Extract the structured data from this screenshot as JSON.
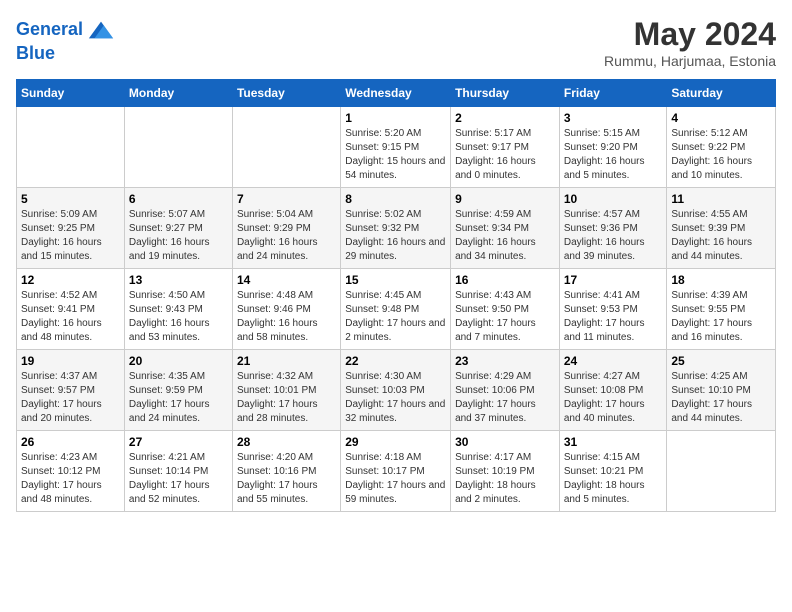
{
  "header": {
    "logo_line1": "General",
    "logo_line2": "Blue",
    "month": "May 2024",
    "location": "Rummu, Harjumaa, Estonia"
  },
  "days_of_week": [
    "Sunday",
    "Monday",
    "Tuesday",
    "Wednesday",
    "Thursday",
    "Friday",
    "Saturday"
  ],
  "weeks": [
    [
      {
        "num": "",
        "info": ""
      },
      {
        "num": "",
        "info": ""
      },
      {
        "num": "",
        "info": ""
      },
      {
        "num": "1",
        "info": "Sunrise: 5:20 AM\nSunset: 9:15 PM\nDaylight: 15 hours and 54 minutes."
      },
      {
        "num": "2",
        "info": "Sunrise: 5:17 AM\nSunset: 9:17 PM\nDaylight: 16 hours and 0 minutes."
      },
      {
        "num": "3",
        "info": "Sunrise: 5:15 AM\nSunset: 9:20 PM\nDaylight: 16 hours and 5 minutes."
      },
      {
        "num": "4",
        "info": "Sunrise: 5:12 AM\nSunset: 9:22 PM\nDaylight: 16 hours and 10 minutes."
      }
    ],
    [
      {
        "num": "5",
        "info": "Sunrise: 5:09 AM\nSunset: 9:25 PM\nDaylight: 16 hours and 15 minutes."
      },
      {
        "num": "6",
        "info": "Sunrise: 5:07 AM\nSunset: 9:27 PM\nDaylight: 16 hours and 19 minutes."
      },
      {
        "num": "7",
        "info": "Sunrise: 5:04 AM\nSunset: 9:29 PM\nDaylight: 16 hours and 24 minutes."
      },
      {
        "num": "8",
        "info": "Sunrise: 5:02 AM\nSunset: 9:32 PM\nDaylight: 16 hours and 29 minutes."
      },
      {
        "num": "9",
        "info": "Sunrise: 4:59 AM\nSunset: 9:34 PM\nDaylight: 16 hours and 34 minutes."
      },
      {
        "num": "10",
        "info": "Sunrise: 4:57 AM\nSunset: 9:36 PM\nDaylight: 16 hours and 39 minutes."
      },
      {
        "num": "11",
        "info": "Sunrise: 4:55 AM\nSunset: 9:39 PM\nDaylight: 16 hours and 44 minutes."
      }
    ],
    [
      {
        "num": "12",
        "info": "Sunrise: 4:52 AM\nSunset: 9:41 PM\nDaylight: 16 hours and 48 minutes."
      },
      {
        "num": "13",
        "info": "Sunrise: 4:50 AM\nSunset: 9:43 PM\nDaylight: 16 hours and 53 minutes."
      },
      {
        "num": "14",
        "info": "Sunrise: 4:48 AM\nSunset: 9:46 PM\nDaylight: 16 hours and 58 minutes."
      },
      {
        "num": "15",
        "info": "Sunrise: 4:45 AM\nSunset: 9:48 PM\nDaylight: 17 hours and 2 minutes."
      },
      {
        "num": "16",
        "info": "Sunrise: 4:43 AM\nSunset: 9:50 PM\nDaylight: 17 hours and 7 minutes."
      },
      {
        "num": "17",
        "info": "Sunrise: 4:41 AM\nSunset: 9:53 PM\nDaylight: 17 hours and 11 minutes."
      },
      {
        "num": "18",
        "info": "Sunrise: 4:39 AM\nSunset: 9:55 PM\nDaylight: 17 hours and 16 minutes."
      }
    ],
    [
      {
        "num": "19",
        "info": "Sunrise: 4:37 AM\nSunset: 9:57 PM\nDaylight: 17 hours and 20 minutes."
      },
      {
        "num": "20",
        "info": "Sunrise: 4:35 AM\nSunset: 9:59 PM\nDaylight: 17 hours and 24 minutes."
      },
      {
        "num": "21",
        "info": "Sunrise: 4:32 AM\nSunset: 10:01 PM\nDaylight: 17 hours and 28 minutes."
      },
      {
        "num": "22",
        "info": "Sunrise: 4:30 AM\nSunset: 10:03 PM\nDaylight: 17 hours and 32 minutes."
      },
      {
        "num": "23",
        "info": "Sunrise: 4:29 AM\nSunset: 10:06 PM\nDaylight: 17 hours and 37 minutes."
      },
      {
        "num": "24",
        "info": "Sunrise: 4:27 AM\nSunset: 10:08 PM\nDaylight: 17 hours and 40 minutes."
      },
      {
        "num": "25",
        "info": "Sunrise: 4:25 AM\nSunset: 10:10 PM\nDaylight: 17 hours and 44 minutes."
      }
    ],
    [
      {
        "num": "26",
        "info": "Sunrise: 4:23 AM\nSunset: 10:12 PM\nDaylight: 17 hours and 48 minutes."
      },
      {
        "num": "27",
        "info": "Sunrise: 4:21 AM\nSunset: 10:14 PM\nDaylight: 17 hours and 52 minutes."
      },
      {
        "num": "28",
        "info": "Sunrise: 4:20 AM\nSunset: 10:16 PM\nDaylight: 17 hours and 55 minutes."
      },
      {
        "num": "29",
        "info": "Sunrise: 4:18 AM\nSunset: 10:17 PM\nDaylight: 17 hours and 59 minutes."
      },
      {
        "num": "30",
        "info": "Sunrise: 4:17 AM\nSunset: 10:19 PM\nDaylight: 18 hours and 2 minutes."
      },
      {
        "num": "31",
        "info": "Sunrise: 4:15 AM\nSunset: 10:21 PM\nDaylight: 18 hours and 5 minutes."
      },
      {
        "num": "",
        "info": ""
      }
    ]
  ]
}
